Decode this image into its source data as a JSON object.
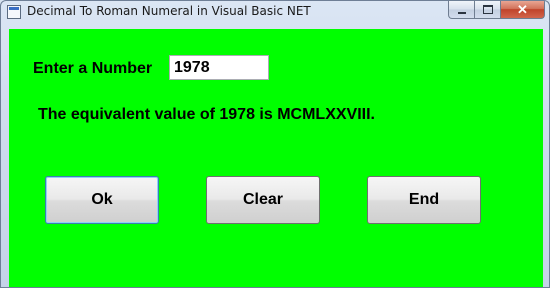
{
  "window": {
    "title": "Decimal To Roman Numeral in Visual Basic NET"
  },
  "caption_buttons": {
    "minimize_icon": "minimize-icon",
    "maximize_icon": "maximize-icon",
    "close_icon": "close-icon",
    "close_glyph": "✕"
  },
  "form": {
    "background_color": "#00ff00",
    "enter_label": "Enter a Number",
    "number_value": "1978",
    "result_text": "The equivalent value of 1978 is MCMLXXVIII."
  },
  "buttons": {
    "ok_label": "Ok",
    "clear_label": "Clear",
    "end_label": "End"
  }
}
